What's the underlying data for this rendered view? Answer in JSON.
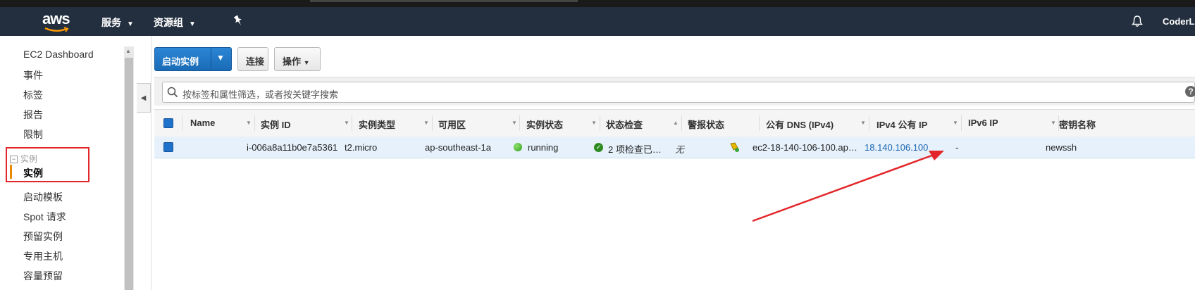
{
  "nav": {
    "logo": "aws",
    "services": "服务",
    "resource_groups": "资源组",
    "user": "CoderLC"
  },
  "sidebar": {
    "items_top": [
      "EC2 Dashboard",
      "事件",
      "标签",
      "报告",
      "限制"
    ],
    "group_label": "实例",
    "active_item": "实例",
    "items_bottom": [
      "启动模板",
      "Spot 请求",
      "预留实例",
      "专用主机",
      "容量预留"
    ]
  },
  "toolbar": {
    "launch_label": "启动实例",
    "connect_label": "连接",
    "actions_label": "操作"
  },
  "search": {
    "placeholder": "按标签和属性筛选，或者按关键字搜索"
  },
  "table": {
    "columns": [
      "Name",
      "实例 ID",
      "实例类型",
      "可用区",
      "实例状态",
      "状态检查",
      "警报状态",
      "公有 DNS (IPv4)",
      "IPv4 公有 IP",
      "IPv6 IP",
      "密钥名称"
    ],
    "rows": [
      {
        "name": "",
        "instance_id": "i-006a8a11b0e7a5361",
        "type": "t2.micro",
        "zone": "ap-southeast-1a",
        "state": "running",
        "status_check": "2 项检查已…",
        "alarm": "无",
        "dns": "ec2-18-140-106-100.ap…",
        "ipv4": "18.140.106.100",
        "ipv6": "-",
        "key": "newssh"
      }
    ]
  },
  "colors": {
    "nav_bg": "#232f3e",
    "accent_orange": "#e88a00",
    "primary_blue": "#1a6bb5",
    "highlight_red": "#e3262a",
    "running_green": "#2e9e1e"
  }
}
